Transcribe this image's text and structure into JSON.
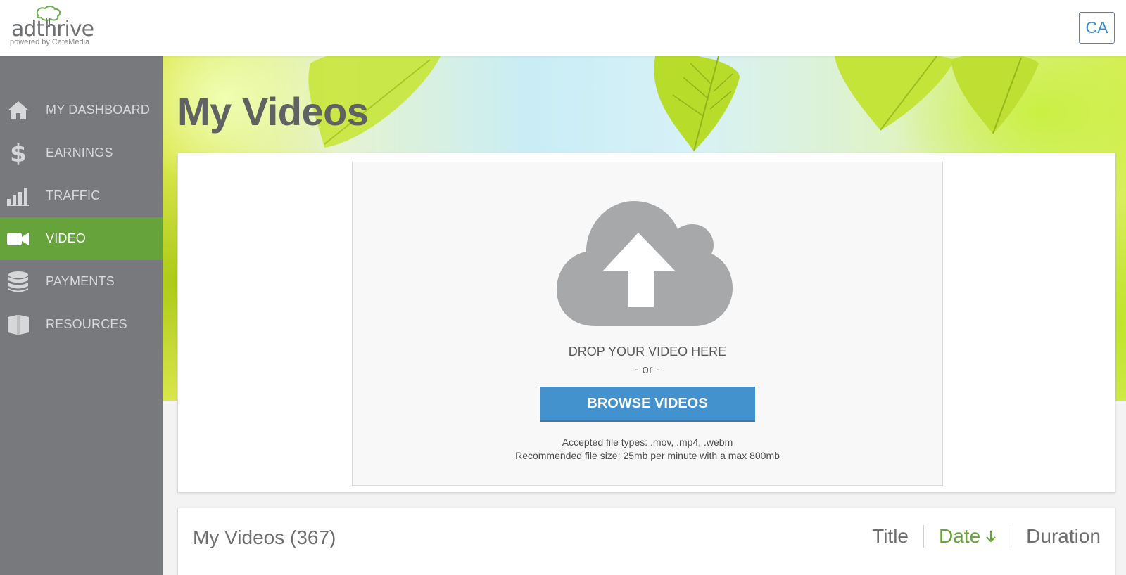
{
  "header": {
    "logo_word": "adthrive",
    "logo_subtitle": "powered by CafeMedia",
    "avatar_initials": "CA"
  },
  "sidebar": {
    "items": [
      {
        "label": "MY DASHBOARD",
        "icon": "home-icon",
        "active": false
      },
      {
        "label": "EARNINGS",
        "icon": "dollar-icon",
        "active": false
      },
      {
        "label": "TRAFFIC",
        "icon": "bar-chart-icon",
        "active": false
      },
      {
        "label": "VIDEO",
        "icon": "video-camera-icon",
        "active": true
      },
      {
        "label": "PAYMENTS",
        "icon": "coin-stack-icon",
        "active": false
      },
      {
        "label": "RESOURCES",
        "icon": "book-icon",
        "active": false
      }
    ]
  },
  "page": {
    "title": "My Videos"
  },
  "upload": {
    "drop_text": "DROP YOUR VIDEO HERE",
    "or_text": "- or -",
    "browse_label": "BROWSE VIDEOS",
    "accepted_types": "Accepted file types: .mov, .mp4, .webm",
    "recommended_size": "Recommended file size: 25mb per minute with a max 800mb"
  },
  "videos": {
    "title": "My Videos (367)",
    "sort": {
      "title_label": "Title",
      "date_label": "Date",
      "duration_label": "Duration",
      "active": "date",
      "direction": "descending"
    }
  },
  "colors": {
    "sidebar_bg": "#77797c",
    "active_green": "#66a33b",
    "button_blue": "#4392cd",
    "avatar_blue": "#3d8fca"
  }
}
